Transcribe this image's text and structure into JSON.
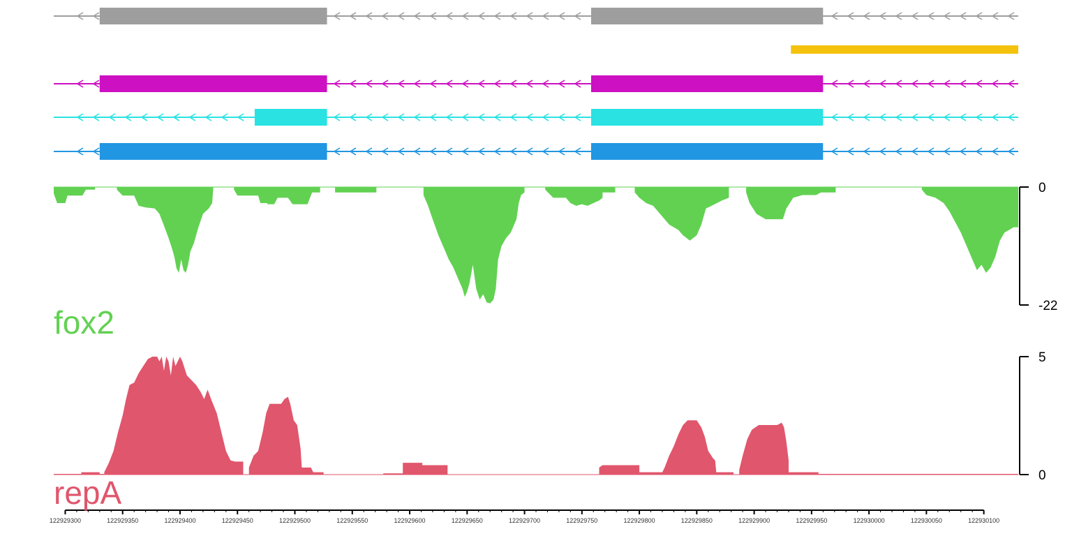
{
  "colors": {
    "annotation": "#9e9e9e",
    "highlight": "#f4c20d",
    "tx1": "#cc10c2",
    "tx2": "#2ae2e2",
    "tx3": "#2196e3",
    "fox2": "#62d152",
    "repA": "#e0566c",
    "axis": "#000000"
  },
  "tracks": {
    "fox2": {
      "label": "fox2"
    },
    "repA": {
      "label": "repA"
    }
  },
  "chart_data": {
    "type": "area",
    "genome_axis": {
      "xlim": [
        122929290,
        122930130
      ],
      "ticks": [
        122929300,
        122929350,
        122929400,
        122929450,
        122929500,
        122929550,
        122929600,
        122929650,
        122929700,
        122929750,
        122929800,
        122929850,
        122929900,
        122929950,
        122930000,
        122930050,
        122930100
      ],
      "tick_labels": [
        "122929300",
        "122929350",
        "122929400",
        "122929450",
        "122929500",
        "122929550",
        "122929600",
        "122929650",
        "122929700",
        "122929750",
        "122929800",
        "122929850",
        "122929900",
        "122929950",
        "122930000",
        "122930050",
        "122930100"
      ]
    },
    "gene_models": [
      {
        "color_key": "annotation",
        "strand": "-",
        "span": [
          122929290,
          122930130
        ],
        "exons": [
          [
            122929330,
            122929528
          ],
          [
            122929758,
            122929960
          ]
        ]
      },
      {
        "color_key": "highlight",
        "strand": "",
        "span": [
          122929932,
          122930130
        ],
        "exons": [
          [
            122929932,
            122930130
          ]
        ]
      },
      {
        "color_key": "tx1",
        "strand": "-",
        "span": [
          122929290,
          122930130
        ],
        "exons": [
          [
            122929330,
            122929528
          ],
          [
            122929758,
            122929960
          ]
        ]
      },
      {
        "color_key": "tx2",
        "strand": "-",
        "span": [
          122929290,
          122930130
        ],
        "exons": [
          [
            122929465,
            122929528
          ],
          [
            122929758,
            122929960
          ]
        ]
      },
      {
        "color_key": "tx3",
        "strand": "-",
        "span": [
          122929290,
          122930130
        ],
        "exons": [
          [
            122929330,
            122929528
          ],
          [
            122929758,
            122929960
          ]
        ]
      }
    ],
    "series": [
      {
        "name": "fox2",
        "ylim": [
          -22,
          0
        ],
        "tick_labels": [
          "0",
          "-22"
        ],
        "points": [
          [
            122929290,
            -1.2
          ],
          [
            122929293,
            -3.0
          ],
          [
            122929300,
            -3.0
          ],
          [
            122929302,
            -1.6
          ],
          [
            122929315,
            -1.6
          ],
          [
            122929318,
            -0.5
          ],
          [
            122929326,
            -0.5
          ],
          [
            122929326,
            0
          ],
          [
            122929345,
            0
          ],
          [
            122929345,
            -0.5
          ],
          [
            122929350,
            -1.6
          ],
          [
            122929360,
            -1.6
          ],
          [
            122929364,
            -3.5
          ],
          [
            122929370,
            -3.8
          ],
          [
            122929378,
            -4.0
          ],
          [
            122929382,
            -5.0
          ],
          [
            122929386,
            -7.2
          ],
          [
            122929390,
            -9.5
          ],
          [
            122929393,
            -11.5
          ],
          [
            122929395,
            -13.0
          ],
          [
            122929397,
            -15.2
          ],
          [
            122929399,
            -16.0
          ],
          [
            122929401,
            -13.5
          ],
          [
            122929403,
            -15.5
          ],
          [
            122929405,
            -16.0
          ],
          [
            122929407,
            -14.5
          ],
          [
            122929409,
            -12.0
          ],
          [
            122929412,
            -10.5
          ],
          [
            122929416,
            -7.5
          ],
          [
            122929420,
            -5.0
          ],
          [
            122929425,
            -4.0
          ],
          [
            122929428,
            -3.0
          ],
          [
            122929429,
            0
          ],
          [
            122929447,
            0
          ],
          [
            122929447,
            -0.5
          ],
          [
            122929450,
            -1.6
          ],
          [
            122929468,
            -1.6
          ],
          [
            122929470,
            -3.0
          ],
          [
            122929476,
            -3.0
          ],
          [
            122929476,
            -3.2
          ],
          [
            122929482,
            -3.2
          ],
          [
            122929485,
            -2.0
          ],
          [
            122929494,
            -2.0
          ],
          [
            122929498,
            -3.2
          ],
          [
            122929511,
            -3.2
          ],
          [
            122929515,
            -1.0
          ],
          [
            122929522,
            -1.0
          ],
          [
            122929522,
            0
          ],
          [
            122929535,
            0
          ],
          [
            122929535,
            -1.0
          ],
          [
            122929571,
            -1.0
          ],
          [
            122929571,
            0
          ],
          [
            122929612,
            0
          ],
          [
            122929612,
            -1.5
          ],
          [
            122929616,
            -3.5
          ],
          [
            122929620,
            -6.0
          ],
          [
            122929625,
            -9.0
          ],
          [
            122929630,
            -11.5
          ],
          [
            122929634,
            -13.5
          ],
          [
            122929638,
            -15.0
          ],
          [
            122929642,
            -17.0
          ],
          [
            122929646,
            -19.0
          ],
          [
            122929648,
            -20.5
          ],
          [
            122929650,
            -19.5
          ],
          [
            122929652,
            -18.0
          ],
          [
            122929655,
            -14.5
          ],
          [
            122929658,
            -19.0
          ],
          [
            122929661,
            -21.0
          ],
          [
            122929664,
            -20.0
          ],
          [
            122929667,
            -21.5
          ],
          [
            122929670,
            -21.7
          ],
          [
            122929673,
            -21.0
          ],
          [
            122929675,
            -19.0
          ],
          [
            122929677,
            -13.5
          ],
          [
            122929680,
            -11.0
          ],
          [
            122929684,
            -9.5
          ],
          [
            122929688,
            -8.5
          ],
          [
            122929690,
            -7.5
          ],
          [
            122929693,
            -6.0
          ],
          [
            122929695,
            -3.0
          ],
          [
            122929697,
            -1.5
          ],
          [
            122929700,
            -1.0
          ],
          [
            122929700,
            0
          ],
          [
            122929718,
            0
          ],
          [
            122929718,
            -0.5
          ],
          [
            122929725,
            -2.0
          ],
          [
            122929736,
            -2.0
          ],
          [
            122929740,
            -3.0
          ],
          [
            122929745,
            -3.5
          ],
          [
            122929750,
            -3.2
          ],
          [
            122929755,
            -3.5
          ],
          [
            122929760,
            -3.0
          ],
          [
            122929765,
            -2.5
          ],
          [
            122929768,
            -2.0
          ],
          [
            122929768,
            -1.0
          ],
          [
            122929779,
            -1.0
          ],
          [
            122929779,
            0
          ],
          [
            122929796,
            0
          ],
          [
            122929796,
            -1.0
          ],
          [
            122929800,
            -2.0
          ],
          [
            122929806,
            -3.0
          ],
          [
            122929812,
            -3.5
          ],
          [
            122929818,
            -5.0
          ],
          [
            122929826,
            -7.0
          ],
          [
            122929834,
            -8.0
          ],
          [
            122929838,
            -9.0
          ],
          [
            122929844,
            -10.0
          ],
          [
            122929850,
            -9.0
          ],
          [
            122929854,
            -7.0
          ],
          [
            122929858,
            -4.0
          ],
          [
            122929863,
            -3.5
          ],
          [
            122929872,
            -2.5
          ],
          [
            122929878,
            -2.0
          ],
          [
            122929878,
            0
          ],
          [
            122929893,
            0
          ],
          [
            122929893,
            -1.0
          ],
          [
            122929896,
            -3.0
          ],
          [
            122929902,
            -5.0
          ],
          [
            122929910,
            -6.0
          ],
          [
            122929925,
            -6.0
          ],
          [
            122929928,
            -4.0
          ],
          [
            122929934,
            -2.0
          ],
          [
            122929942,
            -1.5
          ],
          [
            122929954,
            -1.5
          ],
          [
            122929958,
            -1.0
          ],
          [
            122929971,
            -1.0
          ],
          [
            122929971,
            0
          ],
          [
            122930046,
            0
          ],
          [
            122930046,
            -0.5
          ],
          [
            122930050,
            -1.5
          ],
          [
            122930058,
            -2.0
          ],
          [
            122930065,
            -3.0
          ],
          [
            122930070,
            -4.5
          ],
          [
            122930075,
            -6.5
          ],
          [
            122930080,
            -8.5
          ],
          [
            122930085,
            -11.0
          ],
          [
            122930090,
            -13.5
          ],
          [
            122930094,
            -15.5
          ],
          [
            122930098,
            -14.5
          ],
          [
            122930102,
            -16.0
          ],
          [
            122930106,
            -15.0
          ],
          [
            122930110,
            -13.0
          ],
          [
            122930114,
            -10.0
          ],
          [
            122930118,
            -8.5
          ],
          [
            122930122,
            -8.0
          ],
          [
            122930126,
            -7.5
          ],
          [
            122930130,
            -7.5
          ],
          [
            122930130,
            0
          ]
        ]
      },
      {
        "name": "repA",
        "ylim": [
          0,
          5
        ],
        "tick_labels": [
          "0",
          "5"
        ],
        "points": [
          [
            122929290,
            0.03
          ],
          [
            122929314,
            0.03
          ],
          [
            122929314,
            0.1
          ],
          [
            122929330,
            0.1
          ],
          [
            122929330,
            0.03
          ],
          [
            122929334,
            0.03
          ],
          [
            122929334,
            0.1
          ],
          [
            122929338,
            0.5
          ],
          [
            122929342,
            1.0
          ],
          [
            122929346,
            1.8
          ],
          [
            122929350,
            2.5
          ],
          [
            122929353,
            3.2
          ],
          [
            122929356,
            3.8
          ],
          [
            122929360,
            3.9
          ],
          [
            122929364,
            4.3
          ],
          [
            122929368,
            4.6
          ],
          [
            122929372,
            4.9
          ],
          [
            122929376,
            5.0
          ],
          [
            122929380,
            5.0
          ],
          [
            122929382,
            4.8
          ],
          [
            122929384,
            5.0
          ],
          [
            122929386,
            4.4
          ],
          [
            122929388,
            5.0
          ],
          [
            122929390,
            4.8
          ],
          [
            122929392,
            4.2
          ],
          [
            122929394,
            5.0
          ],
          [
            122929396,
            4.6
          ],
          [
            122929398,
            4.8
          ],
          [
            122929400,
            5.0
          ],
          [
            122929402,
            4.8
          ],
          [
            122929406,
            4.2
          ],
          [
            122929410,
            4.0
          ],
          [
            122929414,
            3.8
          ],
          [
            122929418,
            3.5
          ],
          [
            122929421,
            3.2
          ],
          [
            122929424,
            3.6
          ],
          [
            122929427,
            3.2
          ],
          [
            122929432,
            2.6
          ],
          [
            122929436,
            1.8
          ],
          [
            122929440,
            1.0
          ],
          [
            122929444,
            0.6
          ],
          [
            122929448,
            0.55
          ],
          [
            122929455,
            0.55
          ],
          [
            122929455,
            0
          ],
          [
            122929460,
            0
          ],
          [
            122929460,
            0.3
          ],
          [
            122929464,
            0.8
          ],
          [
            122929468,
            1.0
          ],
          [
            122929472,
            1.8
          ],
          [
            122929475,
            2.6
          ],
          [
            122929478,
            3.0
          ],
          [
            122929488,
            3.0
          ],
          [
            122929491,
            3.2
          ],
          [
            122929494,
            3.3
          ],
          [
            122929496,
            3.0
          ],
          [
            122929499,
            2.3
          ],
          [
            122929502,
            2.1
          ],
          [
            122929505,
            1.1
          ],
          [
            122929506,
            0.3
          ],
          [
            122929514,
            0.3
          ],
          [
            122929516,
            0.1
          ],
          [
            122929525,
            0.1
          ],
          [
            122929525,
            0
          ],
          [
            122929577,
            0
          ],
          [
            122929577,
            0.05
          ],
          [
            122929594,
            0.05
          ],
          [
            122929594,
            0.5
          ],
          [
            122929611,
            0.5
          ],
          [
            122929611,
            0.4
          ],
          [
            122929633,
            0.4
          ],
          [
            122929633,
            0
          ],
          [
            122929765,
            0
          ],
          [
            122929765,
            0.3
          ],
          [
            122929768,
            0.4
          ],
          [
            122929800,
            0.4
          ],
          [
            122929800,
            0.1
          ],
          [
            122929820,
            0.1
          ],
          [
            122929822,
            0.3
          ],
          [
            122929826,
            0.8
          ],
          [
            122929830,
            1.2
          ],
          [
            122929834,
            1.7
          ],
          [
            122929838,
            2.1
          ],
          [
            122929842,
            2.3
          ],
          [
            122929850,
            2.3
          ],
          [
            122929854,
            2.0
          ],
          [
            122929857,
            1.6
          ],
          [
            122929860,
            1.0
          ],
          [
            122929864,
            0.7
          ],
          [
            122929866,
            0.6
          ],
          [
            122929867,
            0.1
          ],
          [
            122929882,
            0.1
          ],
          [
            122929882,
            0
          ],
          [
            122929887,
            0
          ],
          [
            122929887,
            0.2
          ],
          [
            122929890,
            0.8
          ],
          [
            122929894,
            1.5
          ],
          [
            122929898,
            1.9
          ],
          [
            122929904,
            2.1
          ],
          [
            122929920,
            2.1
          ],
          [
            122929924,
            2.2
          ],
          [
            122929926,
            2.0
          ],
          [
            122929928,
            1.4
          ],
          [
            122929930,
            0.6
          ],
          [
            122929930,
            0.1
          ],
          [
            122929956,
            0.1
          ],
          [
            122929956,
            0.03
          ],
          [
            122930130,
            0.03
          ],
          [
            122930130,
            0
          ]
        ]
      }
    ]
  }
}
